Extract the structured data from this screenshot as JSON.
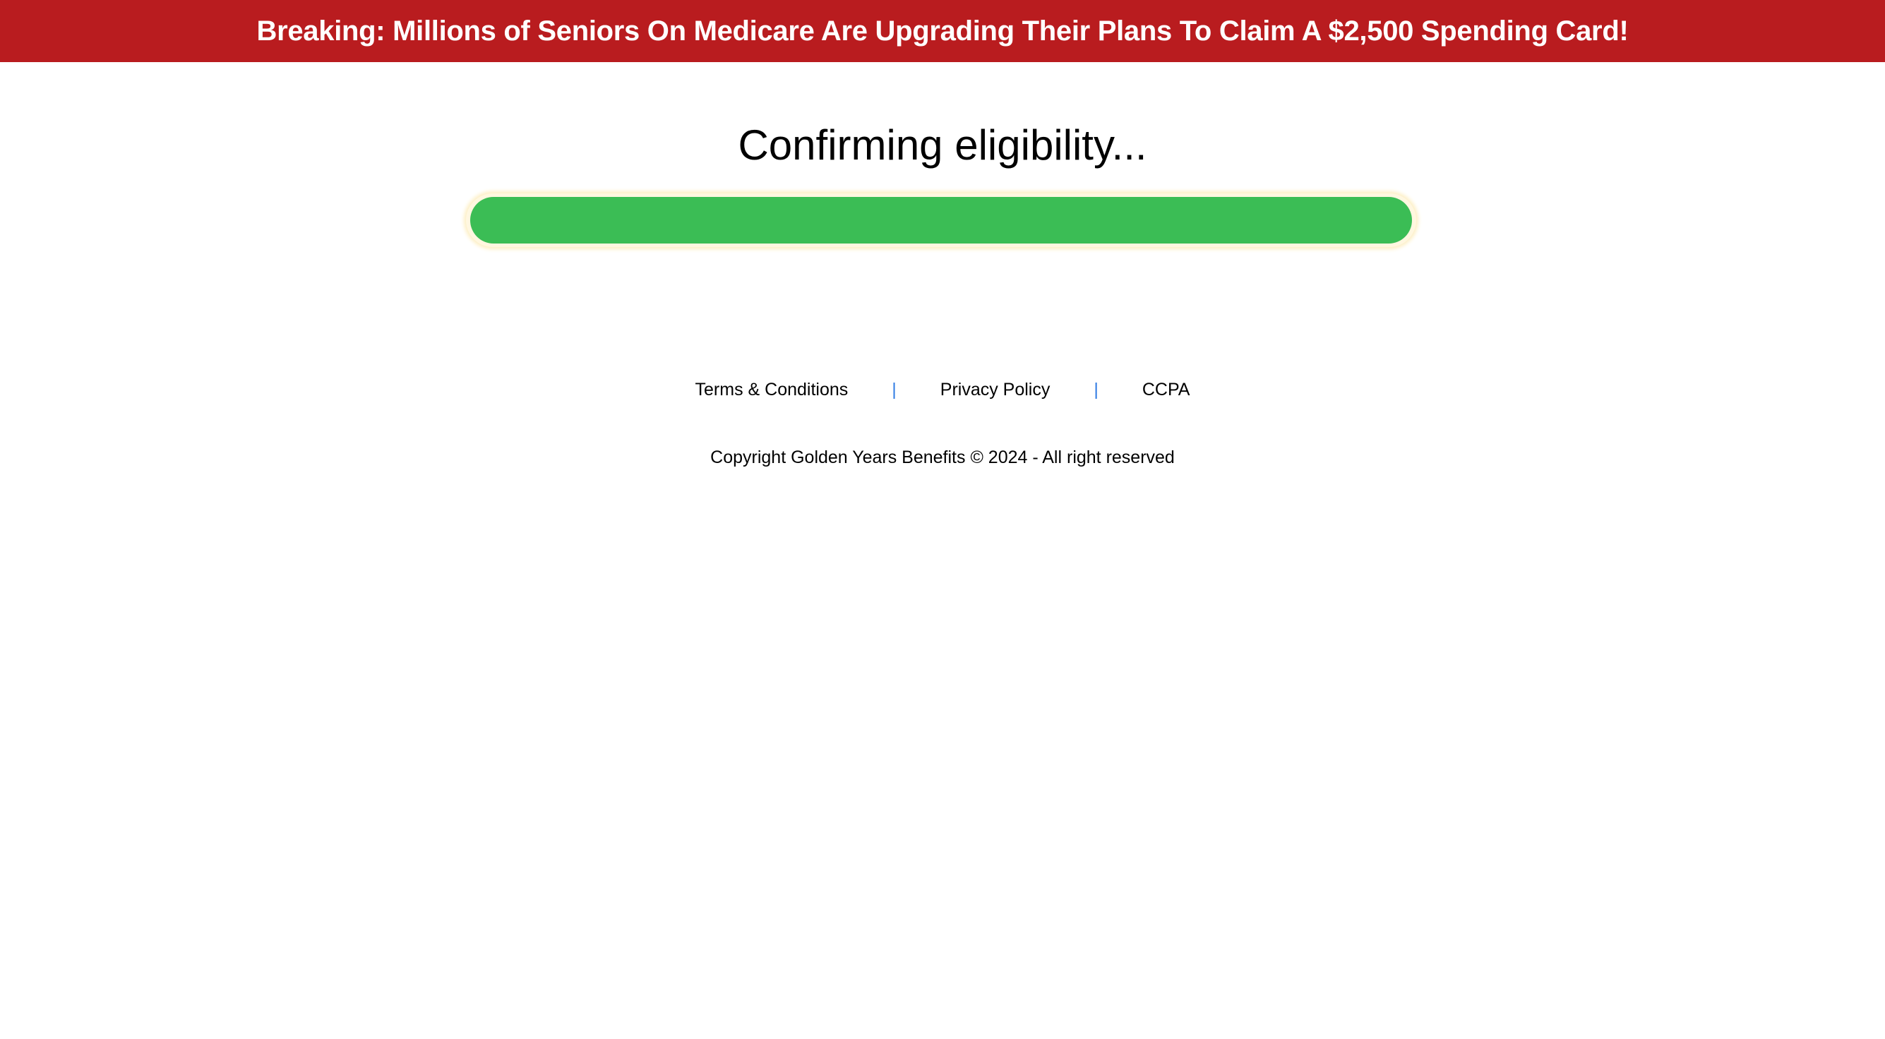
{
  "banner": {
    "text": "Breaking: Millions of Seniors On Medicare Are Upgrading Their Plans To Claim A $2,500 Spending Card!",
    "background_color": "#b91c1f"
  },
  "main": {
    "heading": "Confirming eligibility...",
    "progress": {
      "percent": 100,
      "fill_color": "#3bbd55"
    }
  },
  "footer": {
    "links": [
      {
        "label": "Terms & Conditions"
      },
      {
        "label": "Privacy Policy"
      },
      {
        "label": "CCPA"
      }
    ],
    "separator": "|",
    "separator_color": "#2f7be3",
    "copyright": "Copyright Golden Years Benefits © 2024 - All right reserved"
  }
}
